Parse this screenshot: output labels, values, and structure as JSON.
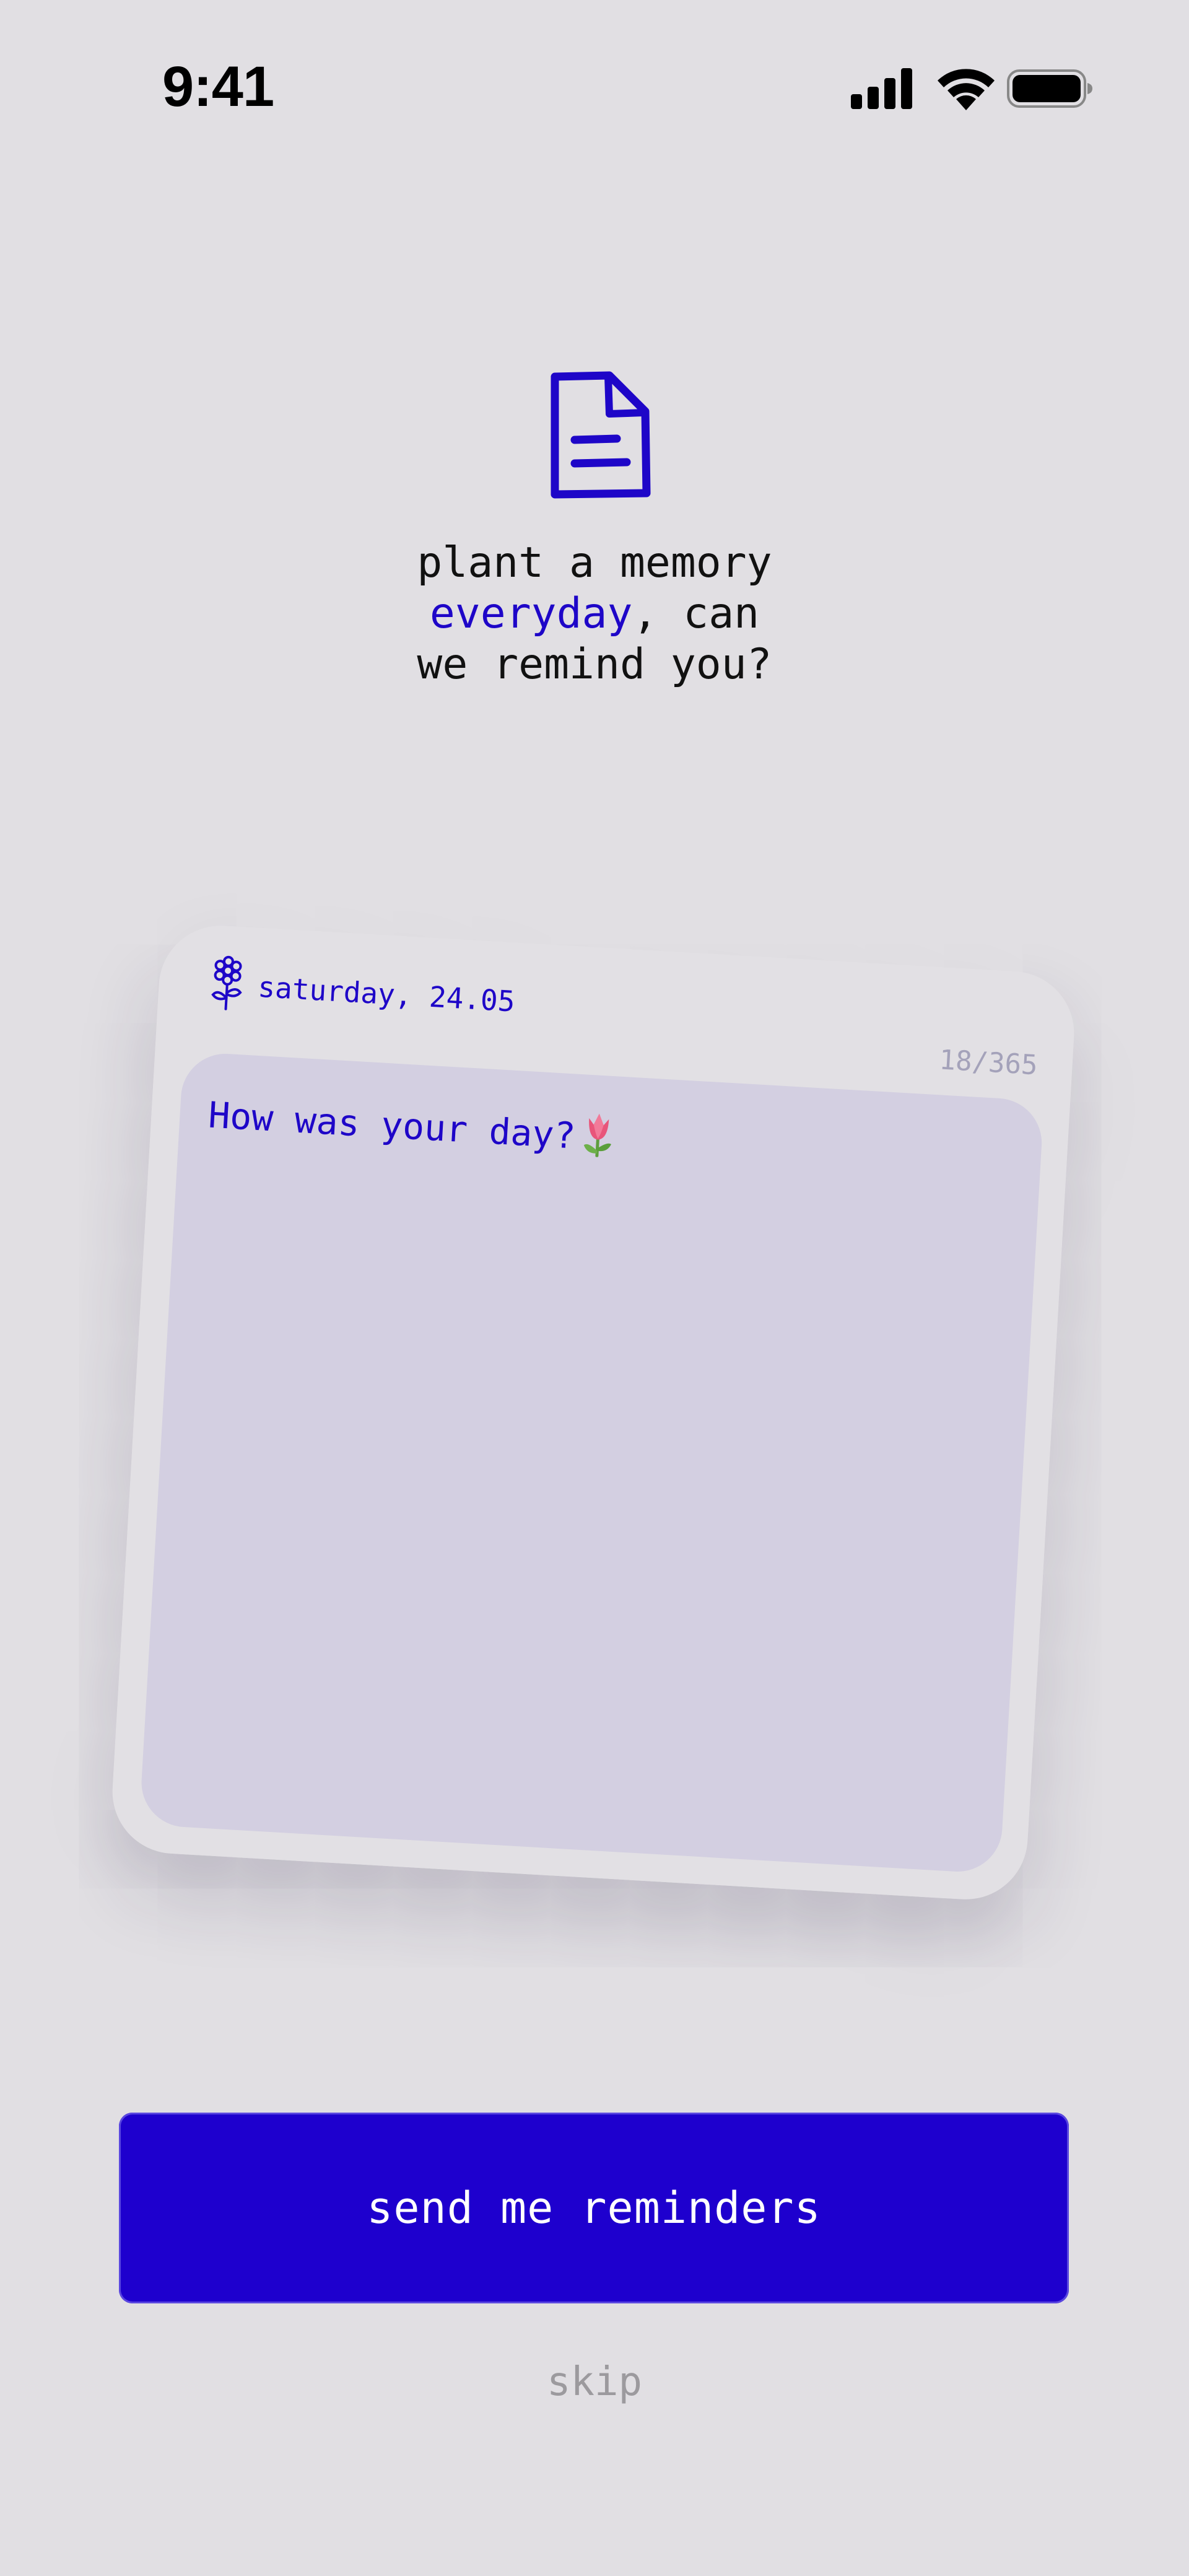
{
  "status_bar": {
    "time": "9:41"
  },
  "hero": {
    "icon": "document-icon",
    "headline_line1": "plant a memory",
    "headline_accent": "everyday",
    "headline_line2_rest": ", can",
    "headline_line3": "we remind you?"
  },
  "card": {
    "icon": "flower-icon",
    "date": "saturday, 24.05",
    "counter": "18/365",
    "prompt": "How was your day?",
    "prompt_emoji_icon": "tulip-icon"
  },
  "actions": {
    "primary_label": "send me reminders",
    "skip_label": "skip"
  },
  "colors": {
    "background": "#E1DFE3",
    "accent": "#1E06C8",
    "button": "#1E00CE",
    "card": "#E2E0E4",
    "card_inner": "#D3CFE1",
    "muted": "#9C9A9E"
  }
}
